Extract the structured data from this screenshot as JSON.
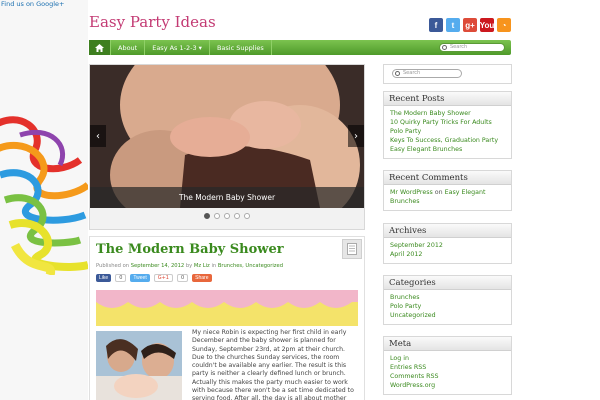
{
  "top_link": "Find us on Google+",
  "site": {
    "title": "Easy Party Ideas"
  },
  "social_icons": [
    {
      "name": "facebook-icon",
      "glyph": "f",
      "color": "#3b5998"
    },
    {
      "name": "twitter-icon",
      "glyph": "t",
      "color": "#55acee"
    },
    {
      "name": "googleplus-icon",
      "glyph": "g+",
      "color": "#dd4b39"
    },
    {
      "name": "youtube-icon",
      "glyph": "You",
      "color": "#cc181e"
    },
    {
      "name": "rss-icon",
      "glyph": "◔",
      "color": "#f7941d"
    }
  ],
  "nav": {
    "items": [
      {
        "label": "About"
      },
      {
        "label": "Easy As 1-2-3 ▾"
      },
      {
        "label": "Basic Supplies"
      }
    ],
    "search_placeholder": "Search"
  },
  "slider": {
    "caption": "The Modern Baby Shower",
    "prev": "‹",
    "next": "›",
    "dot_count": 5,
    "active_dot": 0
  },
  "post": {
    "title": "The Modern Baby Shower",
    "meta": {
      "published_prefix": "Published on",
      "date": "September 14, 2012",
      "by": "by",
      "author": "Mz Liz",
      "in": "in",
      "categories": "Brunches, Uncategorized"
    },
    "share": {
      "like": "Like",
      "like_count": "0",
      "tweet": "Tweet",
      "gplus": "G+1",
      "gplus_count": "0",
      "share": "Share"
    },
    "body": "My niece Robin is expecting her first child in early December and the baby shower is planned for Sunday, September 23rd, at 2pm at their church. Due to the churches Sunday services, the room couldn't be available any earlier. The result is this party is neither a clearly defined lunch or brunch. Actually this makes the party much easier to work with because there won't be a set time dedicated to serving food. After all, the day is all about mother and baby, so this gives more time for that."
  },
  "sidebar": {
    "search_placeholder": "Search",
    "recent_posts": {
      "title": "Recent Posts",
      "items": [
        "The Modern Baby Shower",
        "10 Quirky Party Tricks For Adults",
        "Polo Party",
        "Keys To Success, Graduation Party",
        "Easy Elegant Brunches"
      ]
    },
    "recent_comments": {
      "title": "Recent Comments",
      "author": "Mr WordPress",
      "on": "on",
      "post": "Easy Elegant Brunches"
    },
    "archives": {
      "title": "Archives",
      "items": [
        "September 2012",
        "April 2012"
      ]
    },
    "categories": {
      "title": "Categories",
      "items": [
        "Brunches",
        "Polo Party",
        "Uncategorized"
      ]
    },
    "meta": {
      "title": "Meta",
      "items": [
        "Log in",
        "Entries RSS",
        "Comments RSS",
        "WordPress.org"
      ]
    }
  }
}
